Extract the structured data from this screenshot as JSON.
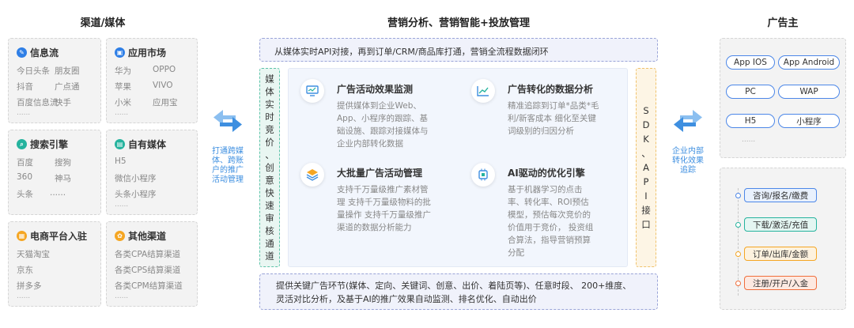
{
  "headers": {
    "left": "渠道/媒体",
    "center": "营销分析、营销智能+投放管理",
    "right": "广告主"
  },
  "left_cards": [
    {
      "title": "信息流",
      "icon": "feed-icon",
      "color": "#2f7fe6",
      "items": [
        [
          "今日头条",
          "朋友圈"
        ],
        [
          "抖音",
          "广点通"
        ],
        [
          "百度信息流",
          "快手"
        ]
      ],
      "more": "......"
    },
    {
      "title": "应用市场",
      "icon": "app-market-icon",
      "color": "#2f7fe6",
      "items": [
        [
          "华为",
          "OPPO"
        ],
        [
          "苹果",
          "VIVO"
        ],
        [
          "小米",
          "应用宝"
        ]
      ],
      "more": "......"
    },
    {
      "title": "搜索引擎",
      "icon": "search-engine-icon",
      "color": "#25b39e",
      "items": [
        [
          "百度",
          "搜狗"
        ],
        [
          "360",
          "神马"
        ],
        [
          "头条",
          "......"
        ]
      ],
      "more": ""
    },
    {
      "title": "自有媒体",
      "icon": "own-media-icon",
      "color": "#25b39e",
      "items": [
        [
          "H5",
          ""
        ],
        [
          "微信小程序",
          ""
        ],
        [
          "头条小程序",
          ""
        ]
      ],
      "more": "......"
    },
    {
      "title": "电商平台入驻",
      "icon": "ecommerce-icon",
      "color": "#f5a623",
      "items": [
        [
          "天猫淘宝",
          ""
        ],
        [
          "京东",
          ""
        ],
        [
          "拼多多",
          ""
        ]
      ],
      "more": "......"
    },
    {
      "title": "其他渠道",
      "icon": "other-channels-icon",
      "color": "#f5a623",
      "items": [
        [
          "各类CPA结算渠道",
          ""
        ],
        [
          "各类CPS结算渠道",
          ""
        ],
        [
          "各类CPM结算渠道",
          ""
        ]
      ],
      "more": "......"
    }
  ],
  "left_arrow_label": [
    "打通跨媒",
    "体、跨账",
    "户的推广",
    "活动管理"
  ],
  "top_bar": "从媒体实时API对接，再到订单/CRM/商品库打通，营销全流程数据闭环",
  "left_vertical": [
    "媒",
    "体",
    "实",
    "时",
    "竞",
    "价",
    "、",
    "创",
    "意",
    "快",
    "速",
    "审",
    "核",
    "通",
    "道"
  ],
  "right_vertical": [
    "S",
    "D",
    "K",
    "、",
    "A",
    "P",
    "I",
    "接",
    "口"
  ],
  "features": [
    {
      "title": "广告活动效果监测",
      "icon": "monitor-icon",
      "desc": [
        "提供媒体到企业Web、",
        "App、小程序的跟踪、基",
        "础设施、跟踪对接媒体与",
        "企业内部转化数据"
      ]
    },
    {
      "title": "广告转化的数据分析",
      "icon": "trend-chart-icon",
      "desc": [
        "精准追踪到订单*品类*毛",
        "利/新客成本  细化至关键",
        "词级别的归因分析"
      ]
    },
    {
      "title": "大批量广告活动管理",
      "icon": "layers-icon",
      "desc": [
        "支持千万量级推广素材管",
        "理  支持千万量级物料的批",
        "量操作  支持千万量级推广",
        "渠道的数据分析能力"
      ]
    },
    {
      "title": "AI驱动的优化引擎",
      "icon": "ai-engine-icon",
      "desc": [
        "基于机器学习的点击",
        "率、转化率、ROI预估",
        "模型，预估每次竞价的",
        "价值用于竞价， 投资组",
        "合算法，指导营销预算",
        "分配"
      ]
    }
  ],
  "bottom_bar": [
    "提供关键广告环节(媒体、定向、关键词、创意、出价、着陆页等)、任意时段、 200+维度、",
    "灵活对比分析，及基于AI的推广效果自动监测、排名优化、自动出价"
  ],
  "right_arrow_label": [
    "企业内部",
    "转化效果",
    "追踪"
  ],
  "platforms": [
    "App IOS",
    "App Android",
    "PC",
    "WAP",
    "H5",
    "小程序"
  ],
  "platforms_more": "......",
  "targets": [
    {
      "label": "咨询/报名/缴费",
      "color": "#4c87e8",
      "bg": "#e9f1fd"
    },
    {
      "label": "下载/激活/充值",
      "color": "#25b39e",
      "bg": "#e4f6f2"
    },
    {
      "label": "订单/出库/金额",
      "color": "#f5a623",
      "bg": "#fdf2df"
    },
    {
      "label": "注册/开户/入金",
      "color": "#f06e3c",
      "bg": "#fde9e1"
    }
  ]
}
